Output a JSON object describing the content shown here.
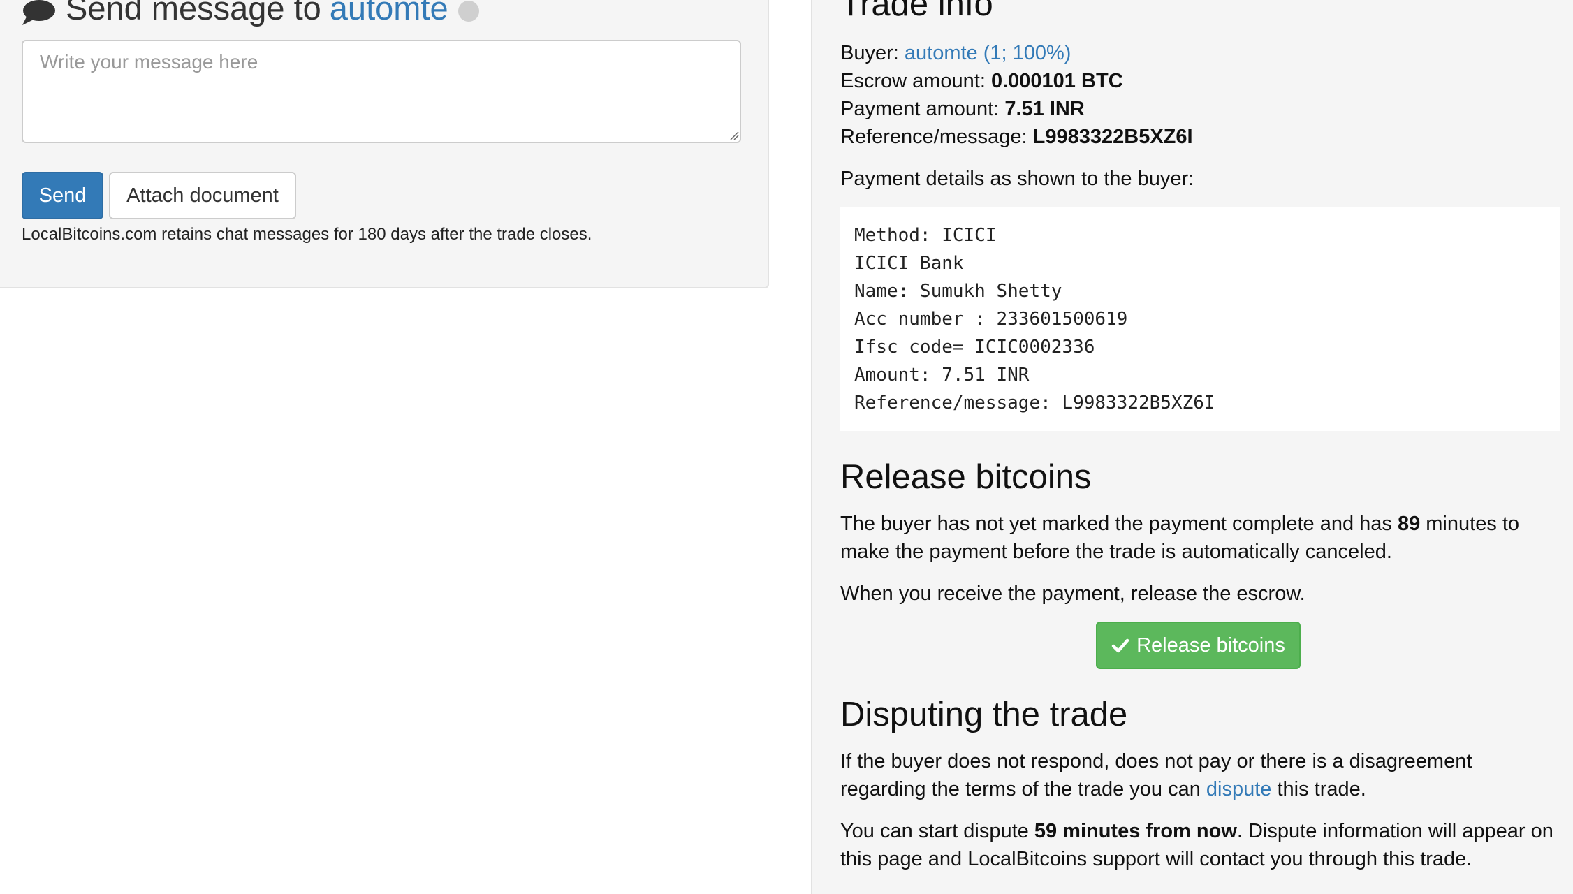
{
  "message_panel": {
    "heading_prefix": "Send message to",
    "recipient": "automte",
    "icon": "chat-bubble-icon",
    "status_icon": "offline-status-icon",
    "textarea_placeholder": "Write your message here",
    "send_label": "Send",
    "attach_label": "Attach document",
    "retention_note": "LocalBitcoins.com retains chat messages for 180 days after the trade closes."
  },
  "trade_info": {
    "title": "Trade info",
    "buyer_label": "Buyer:",
    "buyer_link": "automte (1; 100%)",
    "escrow_label": "Escrow amount:",
    "escrow_value": "0.000101 BTC",
    "payment_label": "Payment amount:",
    "payment_value": "7.51 INR",
    "reference_label": "Reference/message:",
    "reference_value": "L9983322B5XZ6I",
    "payment_details_intro": "Payment details as shown to the buyer:",
    "payment_details_lines": [
      "Method: ICICI",
      "ICICI Bank",
      "Name: Sumukh Shetty",
      "Acc number : 233601500619",
      "Ifsc code= ICIC0002336",
      "Amount: 7.51 INR",
      "Reference/message: L9983322B5XZ6I"
    ]
  },
  "release": {
    "title": "Release bitcoins",
    "para1_before": "The buyer has not yet marked the payment complete and has ",
    "para1_bold": "89",
    "para1_after": " minutes to make the payment before the trade is automatically canceled.",
    "para2": "When you receive the payment, release the escrow.",
    "button_label": "Release bitcoins",
    "button_icon": "check-icon",
    "button_color": "#5cb85c"
  },
  "dispute": {
    "title": "Disputing the trade",
    "para1_before": "If the buyer does not respond, does not pay or there is a disagreement regarding the terms of the trade you can ",
    "para1_link": "dispute",
    "para1_after": " this trade.",
    "para2_before": "You can start dispute ",
    "para2_bold": "59 minutes from now",
    "para2_after": ". Dispute information will appear on this page and LocalBitcoins support will contact you through this trade."
  },
  "colors": {
    "link": "#337ab7",
    "primary_button": "#337ab7",
    "success_button": "#5cb85c",
    "panel_background": "#f5f5f5"
  }
}
